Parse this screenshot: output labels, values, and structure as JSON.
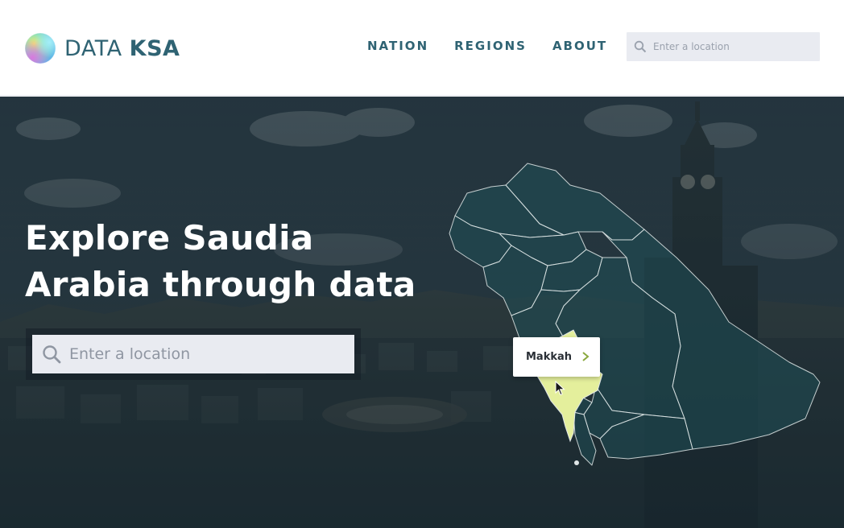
{
  "brand": {
    "prefix": "DATA",
    "suffix": "KSA",
    "logo_icon": "gradient-orb-logo",
    "color": "#2f6373"
  },
  "nav": {
    "items": [
      {
        "label": "NATION"
      },
      {
        "label": "REGIONS"
      },
      {
        "label": "ABOUT"
      }
    ]
  },
  "header_search": {
    "placeholder": "Enter a location",
    "icon": "search-icon"
  },
  "hero": {
    "title_line1": "Explore Saudia",
    "title_line2": "Arabia through data",
    "search_placeholder": "Enter a location",
    "search_icon": "search-icon",
    "background": "aerial photo of Makkah with clock tower"
  },
  "map": {
    "highlighted_region": "Makkah",
    "highlight_color": "#e4ef9c",
    "tooltip_label": "Makkah",
    "tooltip_icon": "chevron-right-icon",
    "accent_color": "#8aa83d"
  }
}
